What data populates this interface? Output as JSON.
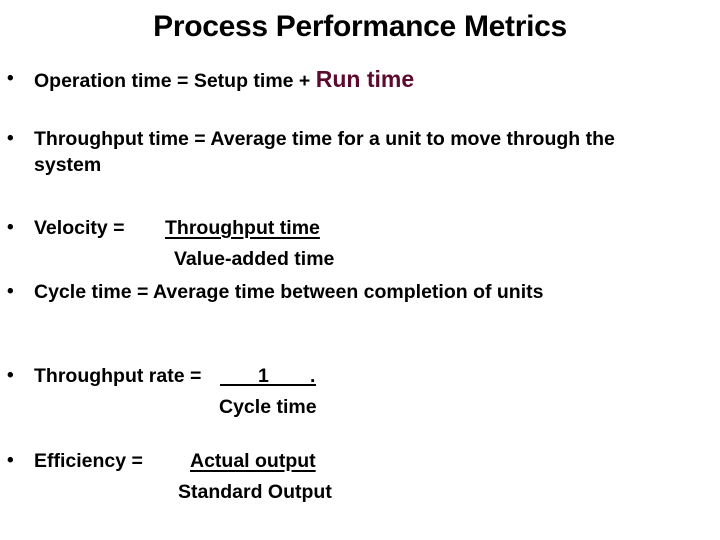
{
  "slide": {
    "title": "Process Performance Metrics",
    "bullet_glyph": "•",
    "accent_color": "#5c0a2e",
    "items": [
      {
        "id": "operation-time",
        "text": "Operation time = Setup time + ",
        "accent_text": "Run time"
      },
      {
        "id": "throughput-time",
        "line1": "Throughput time = Average time for a unit to move through the",
        "line2": "system"
      },
      {
        "id": "velocity",
        "label": "Velocity =",
        "numerator": "Throughput time",
        "denominator": "Value-added time"
      },
      {
        "id": "cycle-time",
        "text": "Cycle time = Average time between  completion of units"
      },
      {
        "id": "throughput-rate",
        "label": "Throughput rate =",
        "numerator": "1",
        "numerator_trail": ".",
        "denominator": "Cycle time"
      },
      {
        "id": "efficiency",
        "label": "Efficiency =",
        "numerator": "Actual output",
        "denominator": "Standard Output"
      }
    ]
  }
}
